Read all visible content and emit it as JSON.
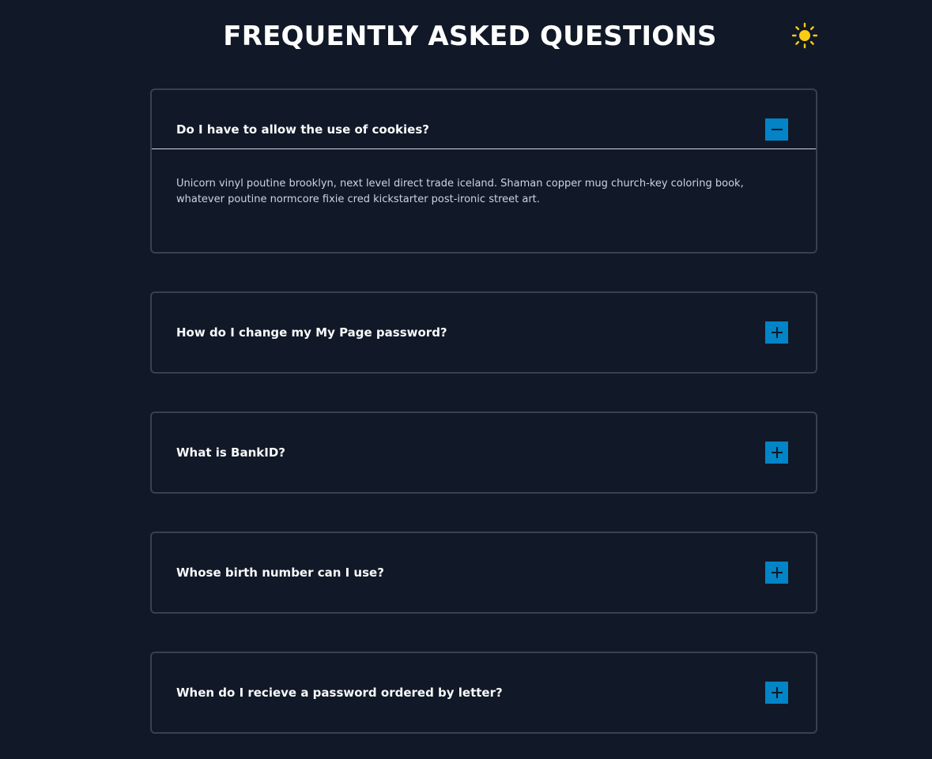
{
  "header": {
    "title": "FREQUENTLY ASKED QUESTIONS",
    "theme_toggle_icon": "sun-icon",
    "theme_toggle_color": "#facc15"
  },
  "colors": {
    "background": "#111827",
    "card_border": "#374151",
    "button": "#0284c7"
  },
  "faq": {
    "items": [
      {
        "question": "Do I have to allow the use of cookies?",
        "answer": "Unicorn vinyl poutine brooklyn, next level direct trade iceland. Shaman copper mug church-key coloring book, whatever poutine normcore fixie cred kickstarter post-ironic street art.",
        "expanded": true,
        "icon": "minus-icon"
      },
      {
        "question": "How do I change my My Page password?",
        "expanded": false,
        "icon": "plus-icon"
      },
      {
        "question": "What is BankID?",
        "expanded": false,
        "icon": "plus-icon"
      },
      {
        "question": "Whose birth number can I use?",
        "expanded": false,
        "icon": "plus-icon"
      },
      {
        "question": "When do I recieve a password ordered by letter?",
        "expanded": false,
        "icon": "plus-icon"
      }
    ]
  }
}
